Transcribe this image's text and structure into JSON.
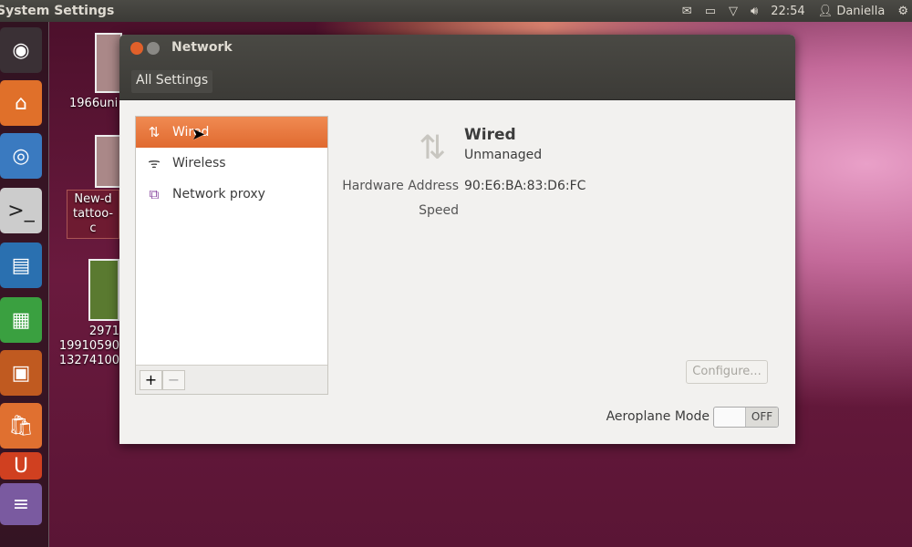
{
  "topbar": {
    "app_title": "System Settings",
    "time": "22:54",
    "user": "Daniella",
    "icons": [
      "mail-icon",
      "battery-icon",
      "wifi-icon",
      "volume-icon",
      "user-icon",
      "gear-icon"
    ]
  },
  "launcher": {
    "items": [
      "dash-home",
      "home-folder",
      "chromium",
      "terminal",
      "libreoffice-writer",
      "libreoffice-calc",
      "libreoffice-impress",
      "software-center",
      "ubuntu-one",
      "workspaces"
    ]
  },
  "desktop": {
    "icons": [
      {
        "label": "1966uni"
      },
      {
        "label": "New-d tattoo-c"
      },
      {
        "label": "2971 19910590 13274100"
      }
    ]
  },
  "window": {
    "title": "Network",
    "all_settings": "All Settings",
    "connections": [
      {
        "label": "Wired",
        "icon": "wired-arrows-icon",
        "selected": true
      },
      {
        "label": "Wireless",
        "icon": "wifi-icon"
      },
      {
        "label": "Network proxy",
        "icon": "proxy-icon"
      }
    ],
    "add": "+",
    "remove": "−",
    "detail": {
      "name": "Wired",
      "status": "Unmanaged",
      "hw_label": "Hardware Address",
      "hw_value": "90:E6:BA:83:D6:FC",
      "speed_label": "Speed"
    },
    "configure": "Configure...",
    "aeroplane_label": "Aeroplane Mode",
    "aeroplane_state": "OFF"
  }
}
